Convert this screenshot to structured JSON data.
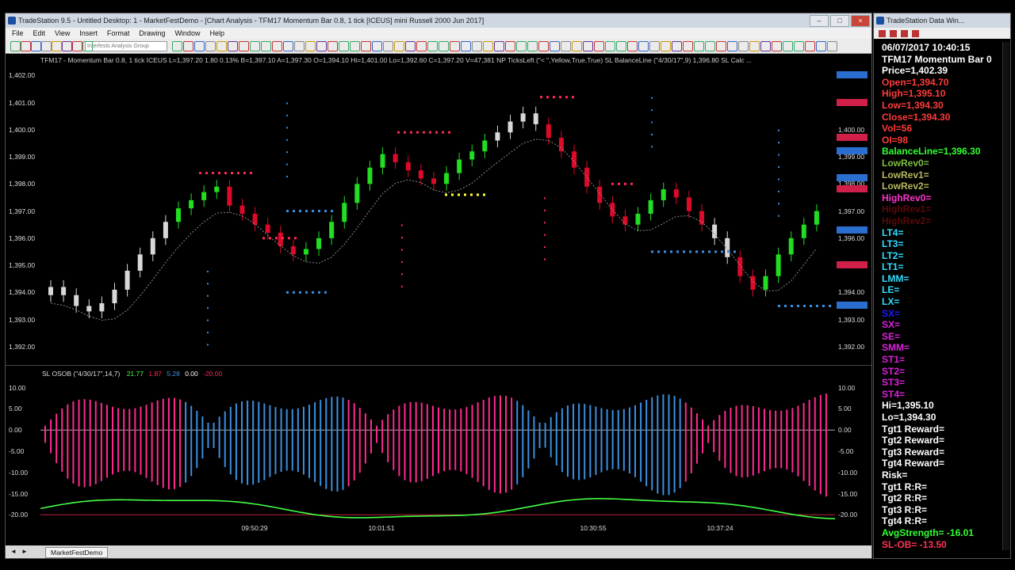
{
  "main_window": {
    "title": "TradeStation 9.5 - Untitled Desktop: 1 - MarketFestDemo - [Chart Analysis - TFM17 Momentum Bar 0.8, 1 tick [ICEUS] mini Russell 2000 Jun 2017]",
    "menu": [
      "File",
      "Edit",
      "View",
      "Insert",
      "Format",
      "Drawing",
      "Window",
      "Help"
    ],
    "toolbar_dropdown": "Interfests Analysis Group",
    "status_line": "TFM17 - Momentum Bar 0.8, 1 tick  ICEUS   L=1,397.20  1.80  0.13%   B=1,397.10  A=1,397.30  O=1,394.10  Hi=1,401.00  Lo=1,392.60  C=1,397.20  V=47,381  NP  TicksLeft (\"< \",Yellow,True,True)   SL  BalanceLine (\"4/30/17\",9)   1,396.80   SL  Calc ...",
    "price_ticks": [
      "1,402.00",
      "1,401.00",
      "1,400.00",
      "1,399.00",
      "1,398.00",
      "1,397.00",
      "1,396.00",
      "1,395.00",
      "1,394.00",
      "1,393.00",
      "1,392.00"
    ],
    "right_price_ticks": [
      "1,400.00",
      "1,399.00",
      "1,398.00",
      "1,397.00",
      "1,396.00",
      "1,395.00",
      "1,394.00",
      "1,393.00",
      "1,392.00"
    ],
    "indicator_label": "SL  OSOB (\"4/30/17\",14,7)",
    "indicator_values": [
      "21.77",
      "1.87",
      "5.28",
      "0.00",
      "-20.00"
    ],
    "osc_ticks": [
      "10.00",
      "5.00",
      "0.00",
      "-5.00",
      "-10.00",
      "-15.00",
      "-20.00"
    ],
    "time_ticks": [
      "09:50:29",
      "10:01:51",
      "10:30:55",
      "10:37:24"
    ],
    "tab_name": "MarketFestDemo"
  },
  "data_window": {
    "title": "TradeStation Data Win...",
    "lines": [
      {
        "text": "06/07/2017 10:40:15",
        "color": "#ffffff"
      },
      {
        "text": "TFM17 Momentum Bar 0",
        "color": "#ffffff"
      },
      {
        "text": "Price=1,402.39",
        "color": "#ffffff"
      },
      {
        "text": "Open=1,394.70",
        "color": "#ff3b3b"
      },
      {
        "text": "High=1,395.10",
        "color": "#ff3b3b"
      },
      {
        "text": "Low=1,394.30",
        "color": "#ff3b3b"
      },
      {
        "text": "Close=1,394.30",
        "color": "#ff3b3b"
      },
      {
        "text": "Vol=56",
        "color": "#ff3b3b"
      },
      {
        "text": "OI=98",
        "color": "#ff3b3b"
      },
      {
        "text": "BalanceLine=1,396.30",
        "color": "#33ff33"
      },
      {
        "text": "LowRev0=",
        "color": "#7fbf3f"
      },
      {
        "text": "LowRev1=",
        "color": "#b8b860"
      },
      {
        "text": "LowRev2=",
        "color": "#b8b860"
      },
      {
        "text": "HighRev0=",
        "color": "#ff33cc"
      },
      {
        "text": "HighRev1=",
        "color": "#5a0a0a"
      },
      {
        "text": "HighRev2=",
        "color": "#5a0a0a"
      },
      {
        "text": "LT4=",
        "color": "#33ddff"
      },
      {
        "text": "LT3=",
        "color": "#33ddff"
      },
      {
        "text": "LT2=",
        "color": "#33ddff"
      },
      {
        "text": "LT1=",
        "color": "#33ddff"
      },
      {
        "text": "LMM=",
        "color": "#33ddff"
      },
      {
        "text": "LE=",
        "color": "#33ddff"
      },
      {
        "text": "LX=",
        "color": "#33ddff"
      },
      {
        "text": "SX=",
        "color": "#1a1aff"
      },
      {
        "text": "SX=",
        "color": "#dd22dd"
      },
      {
        "text": "SE=",
        "color": "#dd22dd"
      },
      {
        "text": "SMM=",
        "color": "#dd22dd"
      },
      {
        "text": "ST1=",
        "color": "#dd22dd"
      },
      {
        "text": "ST2=",
        "color": "#dd22dd"
      },
      {
        "text": "ST3=",
        "color": "#dd22dd"
      },
      {
        "text": "ST4=",
        "color": "#dd22dd"
      },
      {
        "text": "Hi=1,395.10",
        "color": "#ffffff"
      },
      {
        "text": "Lo=1,394.30",
        "color": "#ffffff"
      },
      {
        "text": "Tgt1 Reward=",
        "color": "#ffffff"
      },
      {
        "text": "Tgt2 Reward=",
        "color": "#ffffff"
      },
      {
        "text": "Tgt3 Reward=",
        "color": "#ffffff"
      },
      {
        "text": "Tgt4 Reward=",
        "color": "#ffffff"
      },
      {
        "text": "Risk=",
        "color": "#ffffff"
      },
      {
        "text": "Tgt1 R:R=",
        "color": "#ffffff"
      },
      {
        "text": "Tgt2 R:R=",
        "color": "#ffffff"
      },
      {
        "text": "Tgt3 R:R=",
        "color": "#ffffff"
      },
      {
        "text": "Tgt4 R:R=",
        "color": "#ffffff"
      },
      {
        "text": "AvgStrength= -16.01",
        "color": "#33ff33"
      },
      {
        "text": "SL-OB= -13.50",
        "color": "#ff3355"
      }
    ]
  },
  "colors": {
    "up_bar": "#22dd22",
    "down_bar": "#dd0a2a",
    "neutral_bar": "#d8d8d8",
    "osc_pos": "#ff2a90",
    "osc_neg": "#3a8fe0",
    "avg_line": "#44ff44",
    "dot_red": "#ff2a55",
    "dot_blue": "#3a8fe0",
    "dot_yellow": "#ffff33"
  },
  "chart_data": {
    "type": "candlestick",
    "ylim": [
      1391.5,
      1402.3
    ],
    "closes": [
      1394.2,
      1393.9,
      1393.5,
      1393.3,
      1393.6,
      1394.1,
      1394.8,
      1395.4,
      1396.0,
      1396.6,
      1397.1,
      1397.4,
      1397.7,
      1397.9,
      1397.2,
      1396.9,
      1396.5,
      1396.2,
      1395.7,
      1395.4,
      1395.6,
      1396.0,
      1396.6,
      1397.3,
      1398.0,
      1398.6,
      1399.1,
      1398.8,
      1398.5,
      1398.2,
      1398.0,
      1398.4,
      1398.9,
      1399.2,
      1399.6,
      1399.9,
      1400.3,
      1400.6,
      1400.2,
      1399.7,
      1399.2,
      1398.6,
      1397.9,
      1397.3,
      1396.8,
      1396.5,
      1396.9,
      1397.4,
      1397.8,
      1397.5,
      1397.0,
      1396.5,
      1396.0,
      1395.3,
      1394.6,
      1394.1,
      1394.6,
      1395.4,
      1396.0,
      1396.5,
      1397.0
    ]
  }
}
